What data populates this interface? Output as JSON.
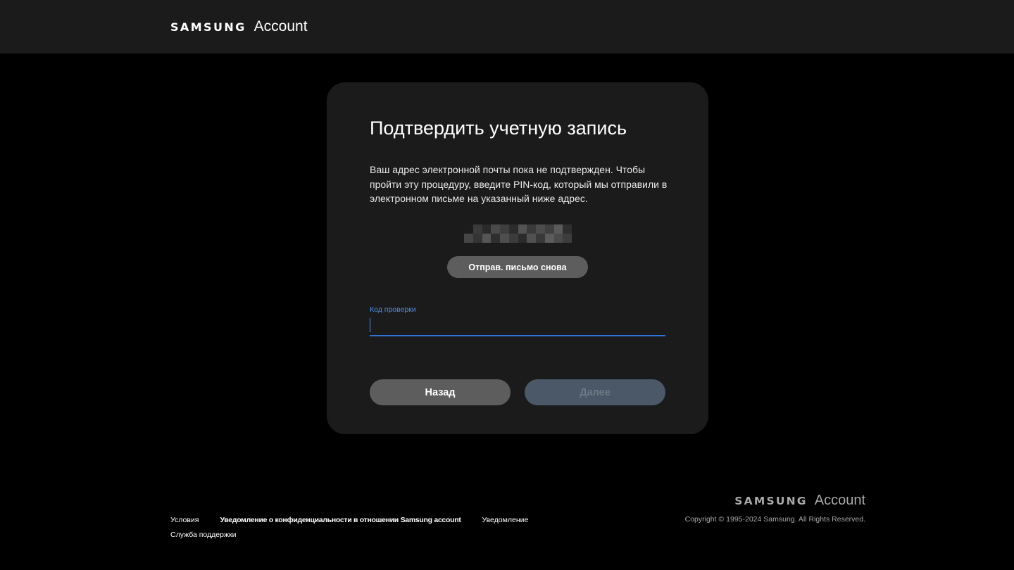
{
  "header": {
    "brand": "SAMSUNG",
    "product": "Account"
  },
  "card": {
    "title": "Подтвердить учетную запись",
    "description": "Ваш адрес электронной почты пока не подтвержден. Чтобы пройти эту процедуру, введите PIN-код, который мы отправили в электронном письме на указанный ниже адрес.",
    "masked_email_pixels": [
      "#1c1c1c",
      "#3a3a3a",
      "#2a2a2a",
      "#4a4a4a",
      "#3e3e3e",
      "#2c2c2c",
      "#535353",
      "#3a3a3a",
      "#4c4c4c",
      "#3f3f3f",
      "#5a5a5a",
      "#2e2e2e",
      "#454545",
      "#343434",
      "#555555",
      "#2f2f2f",
      "#4e4e4e",
      "#3c3c3c",
      "#2b2b2b",
      "#515151",
      "#383838",
      "#5c5c5c",
      "#4a4a4a",
      "#3d3d3d"
    ],
    "resend_button": "Отправ. письмо снова",
    "code_field": {
      "label": "Код проверки",
      "value": "",
      "placeholder": ""
    },
    "back_button": "Назад",
    "next_button": "Далее"
  },
  "footer": {
    "links_row1": [
      "Условия",
      "Уведомление о конфиденциальности в отношении Samsung account",
      "Уведомление"
    ],
    "links_row2": [
      "Служба поддержки"
    ],
    "brand": "SAMSUNG",
    "product": "Account",
    "copyright": "Copyright © 1995-2024 Samsung. All Rights Reserved."
  },
  "colors": {
    "page_background": "#000000",
    "panel_background": "#1b1b1b",
    "accent_blue": "#2f72d6",
    "button_gray": "#5d5d5d",
    "button_disabled": "#4a5868"
  }
}
